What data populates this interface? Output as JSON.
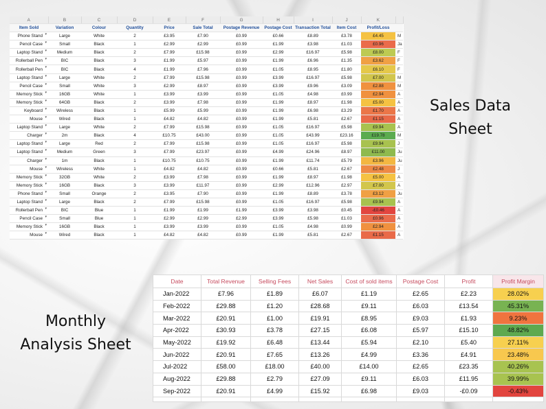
{
  "labels": {
    "sales_line1": "Sales Data",
    "sales_line2": "Sheet",
    "monthly_line1": "Monthly",
    "monthly_line2": "Analysis Sheet"
  },
  "sales_sheet": {
    "column_letters": [
      "A",
      "B",
      "C",
      "D",
      "E",
      "F",
      "G",
      "H",
      "I",
      "J",
      "K",
      ""
    ],
    "headers": [
      "Item Sold",
      "Variation",
      "Colour",
      "Quantity",
      "Price",
      "Sale Total",
      "Postage Revenue",
      "Postage Cost",
      "Transaction Total",
      "Item Cost",
      "Profit/Loss",
      ""
    ],
    "rows": [
      {
        "cells": [
          "Phone Stand",
          "Large",
          "White",
          "2",
          "£3.95",
          "£7.90",
          "£0.99",
          "£0.66",
          "£8.89",
          "£3.78",
          "£4.45",
          "M"
        ],
        "color": "#f5c242"
      },
      {
        "cells": [
          "Pencil Case",
          "Small",
          "Black",
          "1",
          "£2.99",
          "£2.99",
          "£0.99",
          "£1.99",
          "£3.98",
          "£1.03",
          "£0.96",
          "Ja"
        ],
        "color": "#ea6b4b"
      },
      {
        "cells": [
          "Laptop Stand",
          "Medium",
          "Black",
          "2",
          "£7.99",
          "£15.98",
          "£0.99",
          "£2.99",
          "£16.97",
          "£5.98",
          "£8.00",
          "F"
        ],
        "color": "#bdca52"
      },
      {
        "cells": [
          "Rollerball Pen",
          "BIC",
          "Black",
          "3",
          "£1.99",
          "£5.97",
          "£0.99",
          "£1.99",
          "£6.96",
          "£1.35",
          "£3.62",
          "F"
        ],
        "color": "#f0a044"
      },
      {
        "cells": [
          "Rollerball Pen",
          "BIC",
          "Black",
          "4",
          "£1.99",
          "£7.96",
          "£0.99",
          "£1.05",
          "£8.95",
          "£1.80",
          "£6.10",
          "F"
        ],
        "color": "#e5c84a"
      },
      {
        "cells": [
          "Laptop Stand",
          "Large",
          "White",
          "2",
          "£7.99",
          "£15.98",
          "£0.99",
          "£3.99",
          "£16.97",
          "£5.98",
          "£7.00",
          "M"
        ],
        "color": "#d2c64c"
      },
      {
        "cells": [
          "Pencil Case",
          "Small",
          "White",
          "3",
          "£2.99",
          "£8.97",
          "£0.99",
          "£3.99",
          "£9.96",
          "£3.09",
          "£2.88",
          "M"
        ],
        "color": "#f0913f"
      },
      {
        "cells": [
          "Memory Stick",
          "16GB",
          "White",
          "1",
          "£3.99",
          "£3.99",
          "£0.99",
          "£1.05",
          "£4.98",
          "£0.99",
          "£2.94",
          "A"
        ],
        "color": "#f0913f"
      },
      {
        "cells": [
          "Memory Stick",
          "64GB",
          "Black",
          "2",
          "£3.99",
          "£7.98",
          "£0.99",
          "£1.99",
          "£8.97",
          "£1.98",
          "£5.00",
          "A"
        ],
        "color": "#f5c242"
      },
      {
        "cells": [
          "Keyboard",
          "Wireless",
          "Black",
          "1",
          "£5.99",
          "£5.99",
          "£0.99",
          "£1.99",
          "£6.98",
          "£3.29",
          "£1.70",
          "A"
        ],
        "color": "#eb7648"
      },
      {
        "cells": [
          "Mouse",
          "Wired",
          "Black",
          "1",
          "£4.82",
          "£4.82",
          "£0.99",
          "£1.99",
          "£5.81",
          "£2.67",
          "£1.15",
          "A"
        ],
        "color": "#e96a48"
      },
      {
        "cells": [
          "Laptop Stand",
          "Large",
          "White",
          "2",
          "£7.99",
          "£15.98",
          "£0.99",
          "£1.05",
          "£16.97",
          "£5.98",
          "£9.94",
          "A"
        ],
        "color": "#a8c24f"
      },
      {
        "cells": [
          "Charger",
          "2m",
          "Black",
          "4",
          "£10.75",
          "£43.00",
          "£0.99",
          "£1.05",
          "£43.99",
          "£23.16",
          "£19.78",
          "M"
        ],
        "color": "#5bab4f"
      },
      {
        "cells": [
          "Laptop Stand",
          "Large",
          "Red",
          "2",
          "£7.99",
          "£15.98",
          "£0.99",
          "£1.05",
          "£16.97",
          "£5.98",
          "£9.94",
          "J"
        ],
        "color": "#a8c24f"
      },
      {
        "cells": [
          "Laptop Stand",
          "Medium",
          "Green",
          "3",
          "£7.99",
          "£23.97",
          "£0.99",
          "£4.99",
          "£24.96",
          "£8.97",
          "£11.00",
          "Ju"
        ],
        "color": "#8fba4e"
      },
      {
        "cells": [
          "Charger",
          "1m",
          "Black",
          "1",
          "£10.75",
          "£10.75",
          "£0.99",
          "£1.99",
          "£11.74",
          "£5.79",
          "£3.96",
          "Ju"
        ],
        "color": "#f3b742"
      },
      {
        "cells": [
          "Mouse",
          "Wireless",
          "White",
          "1",
          "£4.82",
          "£4.82",
          "£0.99",
          "£0.66",
          "£5.81",
          "£2.67",
          "£2.48",
          "J"
        ],
        "color": "#ee8a45"
      },
      {
        "cells": [
          "Memory Stick",
          "32GB",
          "White",
          "2",
          "£3.99",
          "£7.98",
          "£0.99",
          "£1.99",
          "£8.97",
          "£1.98",
          "£5.00",
          "A"
        ],
        "color": "#f5c242"
      },
      {
        "cells": [
          "Memory Stick",
          "16GB",
          "Black",
          "3",
          "£3.99",
          "£11.97",
          "£0.99",
          "£2.99",
          "£12.96",
          "£2.97",
          "£7.00",
          "A"
        ],
        "color": "#d2c64c"
      },
      {
        "cells": [
          "Phone Stand",
          "Small",
          "Orange",
          "2",
          "£3.95",
          "£7.90",
          "£0.99",
          "£1.99",
          "£8.89",
          "£3.78",
          "£3.12",
          "Ju"
        ],
        "color": "#f0a044"
      },
      {
        "cells": [
          "Laptop Stand",
          "Large",
          "Black",
          "2",
          "£7.99",
          "£15.98",
          "£0.99",
          "£1.05",
          "£16.97",
          "£5.98",
          "£9.94",
          "A"
        ],
        "color": "#a8c24f"
      },
      {
        "cells": [
          "Rollerball Pen",
          "BIC",
          "Blue",
          "1",
          "£1.99",
          "£1.99",
          "£1.99",
          "£3.99",
          "£3.98",
          "£0.45",
          "-£0.46",
          "A"
        ],
        "color": "#e2453f"
      },
      {
        "cells": [
          "Pencil Case",
          "Small",
          "Blue",
          "1",
          "£2.99",
          "£2.99",
          "£2.99",
          "£3.99",
          "£5.98",
          "£1.03",
          "£0.96",
          "A"
        ],
        "color": "#ea6b4b"
      },
      {
        "cells": [
          "Memory Stick",
          "16GB",
          "Black",
          "1",
          "£3.99",
          "£3.99",
          "£0.99",
          "£1.05",
          "£4.98",
          "£0.99",
          "£2.94",
          "A"
        ],
        "color": "#f0913f"
      },
      {
        "cells": [
          "Mouse",
          "Wired",
          "Black",
          "1",
          "£4.82",
          "£4.82",
          "£0.99",
          "£1.99",
          "£5.81",
          "£2.67",
          "£1.15",
          "A"
        ],
        "color": "#e96a48"
      }
    ]
  },
  "monthly_sheet": {
    "headers": [
      "Date",
      "Total Revenue",
      "Selling Fees",
      "Net Sales",
      "Cost of sold items",
      "Postage Cost",
      "Profit",
      "Profit Margin"
    ],
    "rows": [
      {
        "cells": [
          "Jan-2022",
          "£7.96",
          "£1.89",
          "£6.07",
          "£1.19",
          "£2.65",
          "£2.23",
          "28.02%"
        ],
        "color": "#f7d04f"
      },
      {
        "cells": [
          "Feb-2022",
          "£29.88",
          "£1.20",
          "£28.68",
          "£9.11",
          "£6.03",
          "£13.54",
          "45.31%"
        ],
        "color": "#78b352"
      },
      {
        "cells": [
          "Mar-2022",
          "£20.91",
          "£1.00",
          "£19.91",
          "£8.95",
          "£9.03",
          "£1.93",
          "9.23%"
        ],
        "color": "#f0743f"
      },
      {
        "cells": [
          "Apr-2022",
          "£30.93",
          "£3.78",
          "£27.15",
          "£6.08",
          "£5.97",
          "£15.10",
          "48.82%"
        ],
        "color": "#5ea94f"
      },
      {
        "cells": [
          "May-2022",
          "£19.92",
          "£6.48",
          "£13.44",
          "£5.94",
          "£2.10",
          "£5.40",
          "27.11%"
        ],
        "color": "#f7d04f"
      },
      {
        "cells": [
          "Jun-2022",
          "£20.91",
          "£7.65",
          "£13.26",
          "£4.99",
          "£3.36",
          "£4.91",
          "23.48%"
        ],
        "color": "#f8c84e"
      },
      {
        "cells": [
          "Jul-2022",
          "£58.00",
          "£18.00",
          "£40.00",
          "£14.00",
          "£2.65",
          "£23.35",
          "40.26%"
        ],
        "color": "#a8c350"
      },
      {
        "cells": [
          "Aug-2022",
          "£29.88",
          "£2.79",
          "£27.09",
          "£9.11",
          "£6.03",
          "£11.95",
          "39.99%"
        ],
        "color": "#a8c350"
      },
      {
        "cells": [
          "Sep-2022",
          "£20.91",
          "£4.99",
          "£15.92",
          "£6.98",
          "£9.03",
          "-£0.09",
          "-0.43%"
        ],
        "color": "#e2453f"
      }
    ]
  }
}
